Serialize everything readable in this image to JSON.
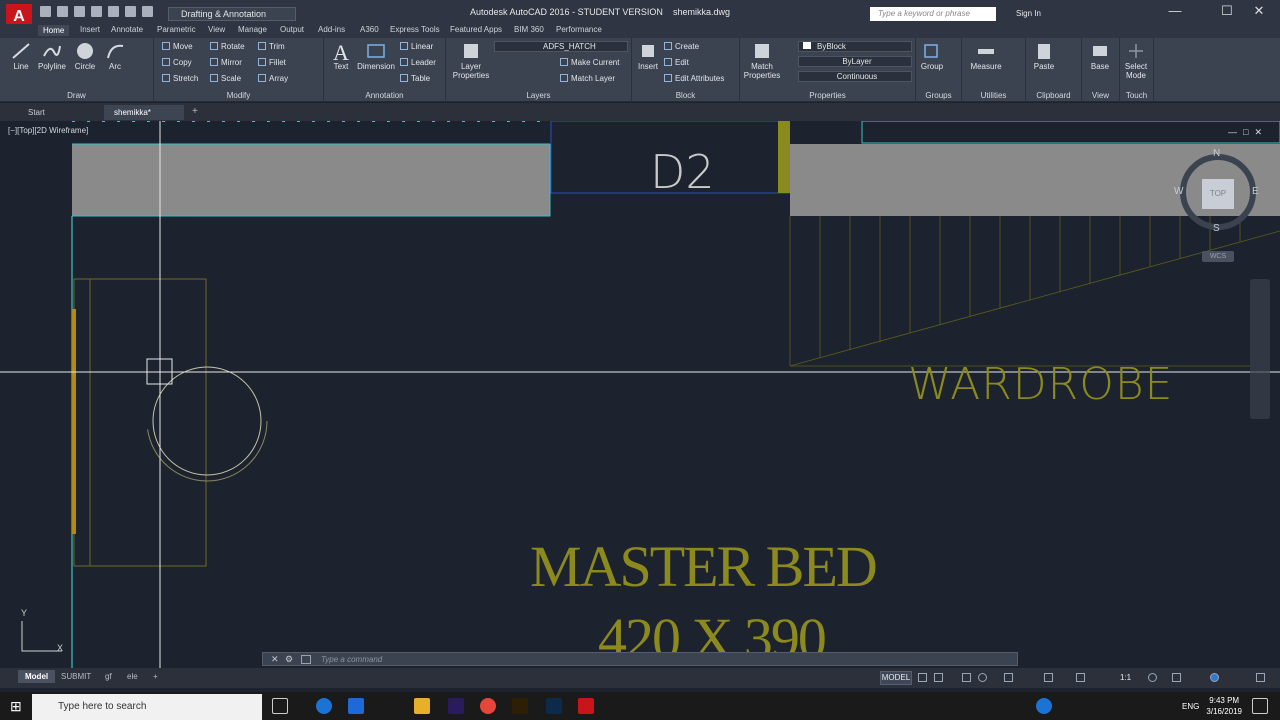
{
  "app": {
    "logo": "A",
    "workspace": "Drafting & Annotation",
    "title": "Autodesk AutoCAD 2016 - STUDENT VERSION",
    "filename": "shemikka.dwg",
    "search_placeholder": "Type a keyword or phrase",
    "signin": "Sign In"
  },
  "ribbon_tabs": [
    "Home",
    "Insert",
    "Annotate",
    "Parametric",
    "View",
    "Manage",
    "Output",
    "Add-ins",
    "A360",
    "Express Tools",
    "Featured Apps",
    "BIM 360",
    "Performance"
  ],
  "panels": {
    "draw": {
      "label": "Draw",
      "line": "Line",
      "polyline": "Polyline",
      "circle": "Circle",
      "arc": "Arc"
    },
    "modify": {
      "label": "Modify",
      "move": "Move",
      "rotate": "Rotate",
      "trim": "Trim",
      "copy": "Copy",
      "mirror": "Mirror",
      "fillet": "Fillet",
      "stretch": "Stretch",
      "scale": "Scale",
      "array": "Array"
    },
    "annotation": {
      "label": "Annotation",
      "text": "Text",
      "dimension": "Dimension",
      "linear": "Linear",
      "leader": "Leader",
      "table": "Table"
    },
    "layers": {
      "label": "Layers",
      "layer_properties": "Layer Properties",
      "current_layer": "ADFS_HATCH",
      "make_current": "Make Current",
      "match_layer": "Match Layer"
    },
    "block": {
      "label": "Block",
      "insert": "Insert",
      "create": "Create",
      "edit": "Edit",
      "edit_attributes": "Edit Attributes"
    },
    "properties": {
      "label": "Properties",
      "match": "Match Properties",
      "color": "ByBlock",
      "linetype": "ByLayer",
      "lineweight": "Continuous"
    },
    "groups": {
      "label": "Groups",
      "group": "Group"
    },
    "utilities": {
      "label": "Utilities",
      "measure": "Measure"
    },
    "clipboard": {
      "label": "Clipboard",
      "paste": "Paste"
    },
    "view": {
      "label": "View",
      "base": "Base"
    },
    "touch": {
      "label": "Touch",
      "select_mode": "Select Mode"
    }
  },
  "doc_tabs": [
    "Start",
    "shemikka*"
  ],
  "viewport": {
    "label": "[−][Top][2D Wireframe]",
    "rooms": {
      "d2": "D2",
      "wardrobe": "WARDROBE",
      "master_bed": "MASTER BED",
      "size": "420 X 390"
    },
    "compass": {
      "n": "N",
      "s": "S",
      "e": "E",
      "w": "W",
      "top": "TOP",
      "wcs": "WCS"
    },
    "ucs": {
      "x": "X",
      "y": "Y"
    }
  },
  "command": {
    "placeholder": "Type a command"
  },
  "layout_tabs": [
    "Model",
    "SUBMIT",
    "gf",
    "ele"
  ],
  "status": {
    "model": "MODEL",
    "scale": "1:1"
  },
  "taskbar": {
    "search": "Type here to search",
    "lang": "ENG",
    "time": "9:43 PM",
    "date": "3/16/2019"
  }
}
